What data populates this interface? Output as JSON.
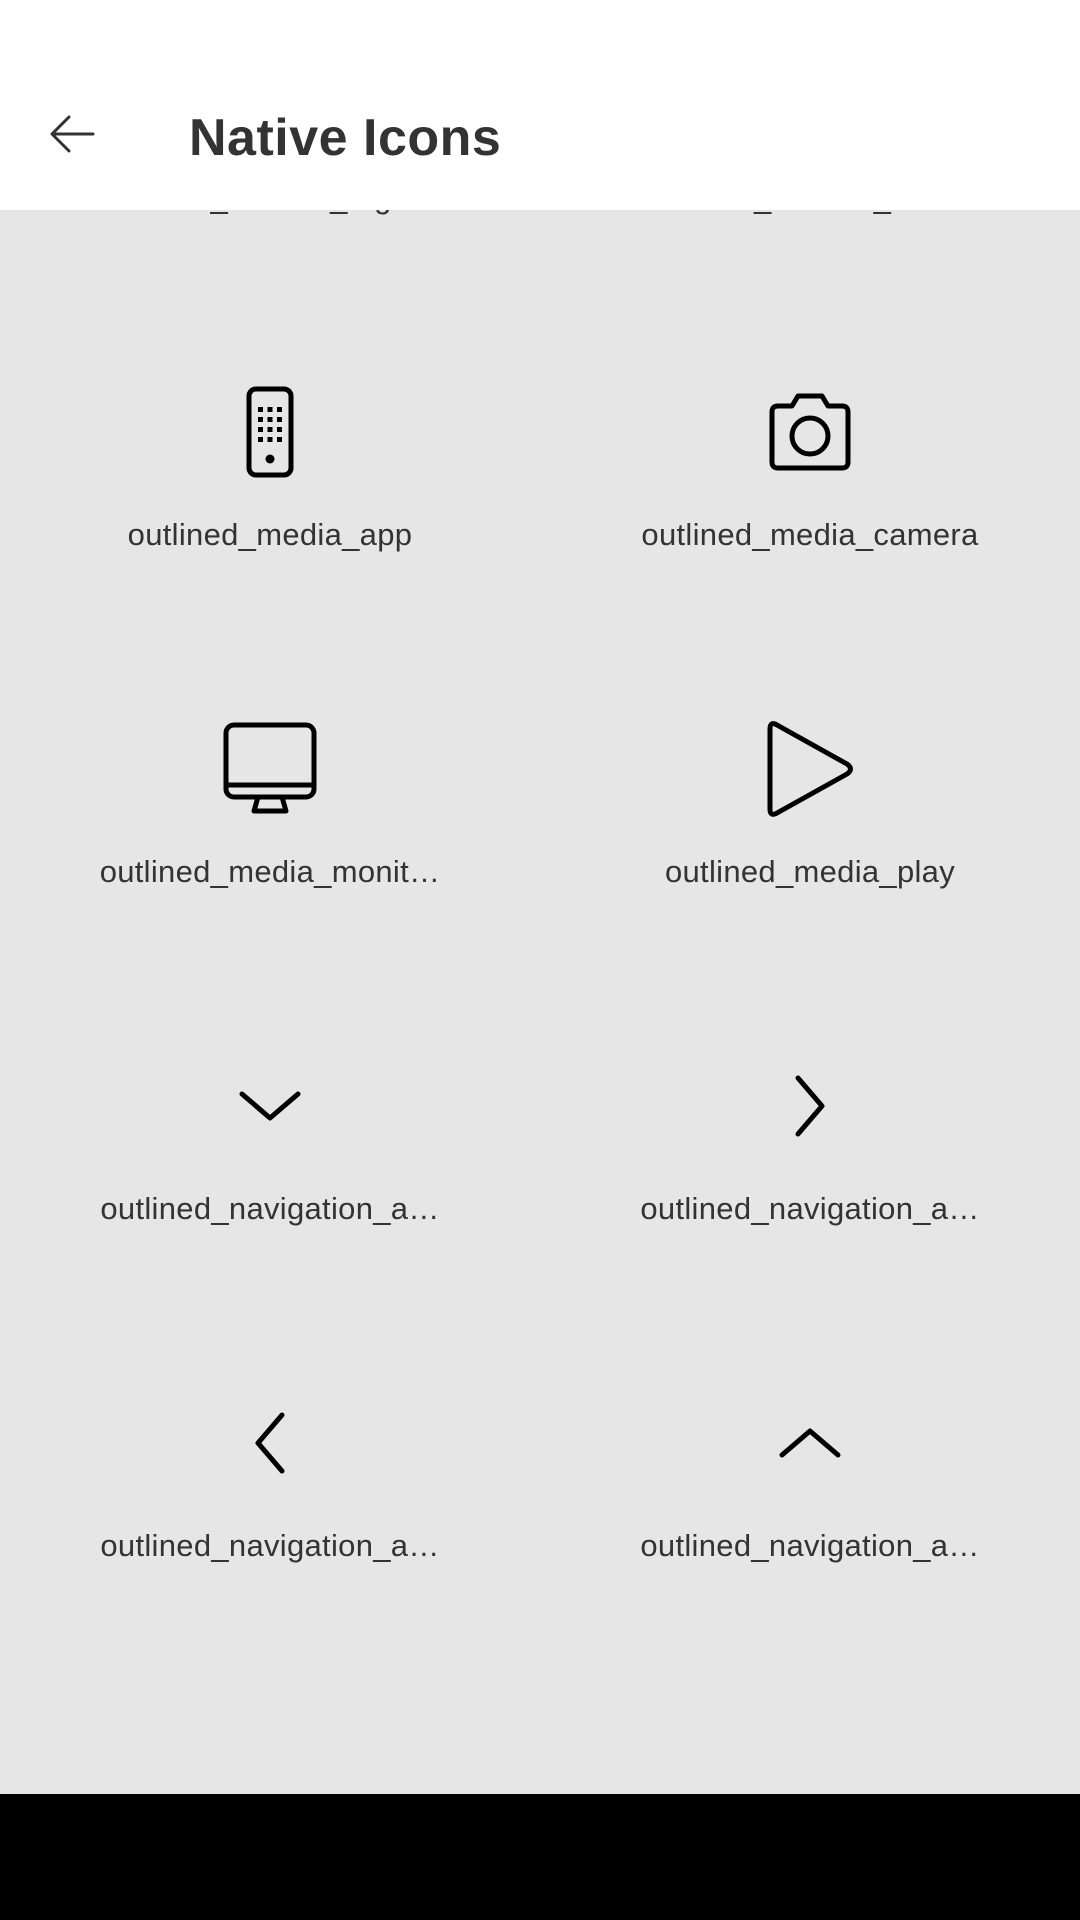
{
  "header": {
    "title": "Native Icons",
    "back_icon": "arrow-left-icon"
  },
  "colors": {
    "app_bar": "#ffffff",
    "content_background": "#e6e6e6",
    "text": "#333333",
    "icon_stroke": "#000000",
    "system_nav_bar": "#000000"
  },
  "icons": [
    {
      "label": "outlined_finance_tagd…",
      "icon": "tag-chevron-icon"
    },
    {
      "label": "outlined_finance_tran…",
      "icon": "transfer-icon"
    },
    {
      "label": "outlined_media_app",
      "icon": "phone-keypad-icon"
    },
    {
      "label": "outlined_media_camera",
      "icon": "camera-icon"
    },
    {
      "label": "outlined_media_monit…",
      "icon": "monitor-icon"
    },
    {
      "label": "outlined_media_play",
      "icon": "play-icon"
    },
    {
      "label": "outlined_navigation_a…",
      "icon": "chevron-down-icon"
    },
    {
      "label": "outlined_navigation_a…",
      "icon": "chevron-right-icon"
    },
    {
      "label": "outlined_navigation_a…",
      "icon": "chevron-left-icon"
    },
    {
      "label": "outlined_navigation_a…",
      "icon": "chevron-up-icon"
    }
  ]
}
